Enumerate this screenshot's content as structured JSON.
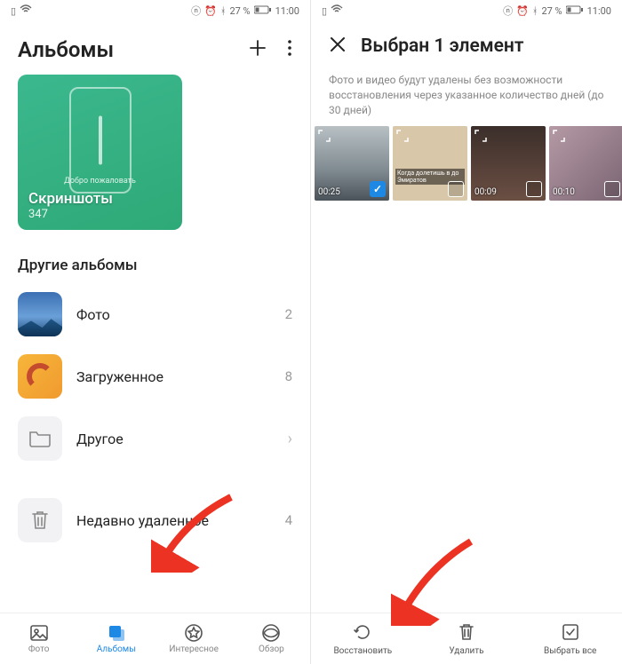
{
  "statusbar": {
    "nfc_bt": "⟊ ⌚ ⚙",
    "battery_text": "27 %",
    "time": "11:00"
  },
  "left": {
    "title": "Альбомы",
    "big_card": {
      "welcome": "Добро пожаловать",
      "title": "Скриншоты",
      "count": "347"
    },
    "other_title": "Другие альбомы",
    "rows": [
      {
        "label": "Фото",
        "count": "2",
        "kind": "photo"
      },
      {
        "label": "Загруженное",
        "count": "8",
        "kind": "dl"
      },
      {
        "label": "Другое",
        "count": "",
        "kind": "folder",
        "chevron": true
      },
      {
        "label": "Недавно удаленное",
        "count": "4",
        "kind": "trash"
      }
    ],
    "bottomnav": [
      {
        "label": "Фото"
      },
      {
        "label": "Альбомы"
      },
      {
        "label": "Интересное"
      },
      {
        "label": "Обзор"
      }
    ]
  },
  "right": {
    "title": "Выбран 1 элемент",
    "info": "Фото и видео будут удалены без возможности восстановления через указанное количество дней (до 30 дней)",
    "thumbs": [
      {
        "duration": "00:25",
        "selected": true,
        "cls": "t1"
      },
      {
        "duration": "",
        "selected": false,
        "cls": "t2",
        "caption": "Когда долетишь в до Эмиратов"
      },
      {
        "duration": "00:09",
        "selected": false,
        "cls": "t3"
      },
      {
        "duration": "00:10",
        "selected": false,
        "cls": "t4"
      }
    ],
    "actions": [
      {
        "label": "Восстановить"
      },
      {
        "label": "Удалить"
      },
      {
        "label": "Выбрать все"
      }
    ]
  }
}
